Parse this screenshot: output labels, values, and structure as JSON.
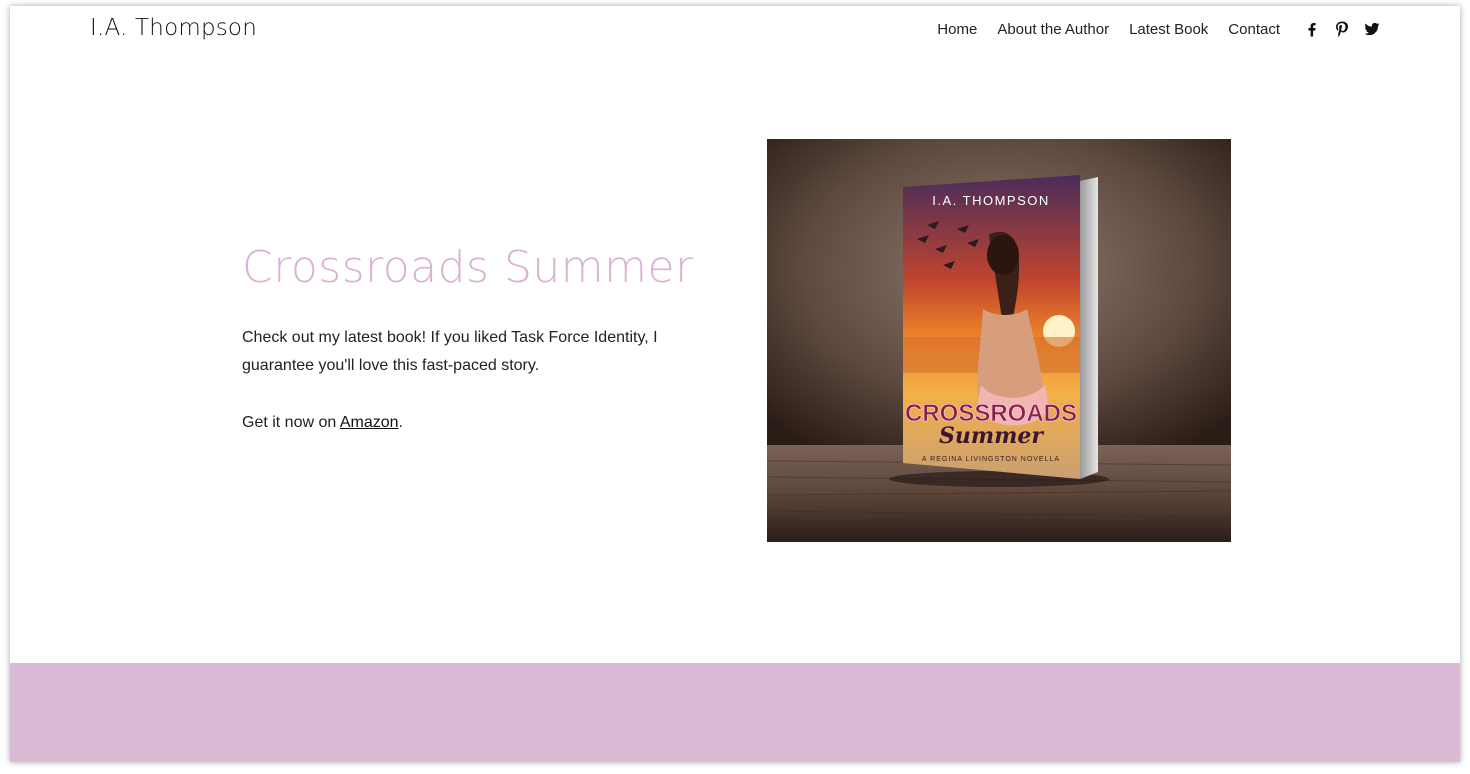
{
  "site": {
    "title": "I.A. Thompson"
  },
  "nav": {
    "items": [
      {
        "label": "Home"
      },
      {
        "label": "About the Author"
      },
      {
        "label": "Latest Book"
      },
      {
        "label": "Contact"
      }
    ]
  },
  "social": {
    "icons": [
      "facebook-icon",
      "pinterest-icon",
      "twitter-icon"
    ]
  },
  "hero": {
    "title": "Crossroads Summer",
    "description": "Check out my latest book! If you liked Task Force Identity, I guarantee you'll love this fast-paced story.",
    "cta_prefix": "Get it now on ",
    "cta_link": "Amazon",
    "cta_suffix": "."
  },
  "book_cover": {
    "author": "I.A. THOMPSON",
    "title_line1": "CROSSROADS",
    "title_line2": "Summer",
    "subtitle": "A REGINA LIVINGSTON NOVELLA"
  },
  "colors": {
    "accent": "#d9b2d4",
    "footer": "#dbbad6",
    "text": "#222222"
  }
}
